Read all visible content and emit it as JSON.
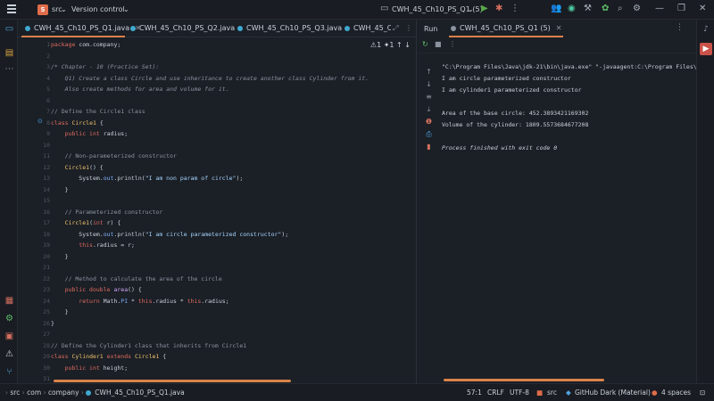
{
  "titlebar": {
    "project_badge": "S",
    "project_name": "src",
    "vcs_label": "Version control",
    "run_config": "CWH_45_Ch10_PS_Q1 (5)",
    "icons": [
      "menu-icon",
      "run-config-icon",
      "run-icon",
      "debug-icon",
      "more-icon",
      "collab-icon",
      "copilot-icon",
      "build-icon",
      "ai-icon",
      "search-icon",
      "settings-icon",
      "minimize-icon",
      "restore-icon",
      "close-icon"
    ]
  },
  "editor_tabs": [
    {
      "label": "CWH_45_Ch10_PS_Q1.java",
      "active": true
    },
    {
      "label": "CWH_45_Ch10_PS_Q2.java",
      "active": false
    },
    {
      "label": "CWH_45_Ch10_PS_Q3.java",
      "active": false
    },
    {
      "label": "CWH_45_C",
      "active": false
    }
  ],
  "editor": {
    "inspections": "⚠1 ✦1",
    "lines": [
      {
        "n": "1",
        "html": "<span class=\"kw\">package</span> com.company;"
      },
      {
        "n": "2",
        "html": ""
      },
      {
        "n": "3",
        "html": "<span class=\"cm\">/* Chapter - 10 (Practice Set):</span>"
      },
      {
        "n": "4",
        "html": "<span class=\"cm\">    Q1) Create a class Circle and use inheritance to create another class Cylinder from it.</span>"
      },
      {
        "n": "5",
        "html": "<span class=\"cm\">    Also create methods for area and volume for it.</span>"
      },
      {
        "n": "6",
        "html": ""
      },
      {
        "n": "7",
        "html": "<span class=\"cmn\">// Define the Circle1 class</span>"
      },
      {
        "n": "8",
        "html": "<span class=\"kw\">class</span> <span class=\"cls\">Circle1</span> {"
      },
      {
        "n": "9",
        "html": "    <span class=\"kw\">public int</span> radius;"
      },
      {
        "n": "10",
        "html": ""
      },
      {
        "n": "11",
        "html": "    <span class=\"cmn\">// Non-parameterized constructor</span>"
      },
      {
        "n": "12",
        "html": "    <span class=\"cls\">Circle1</span>() {"
      },
      {
        "n": "13",
        "html": "        System.<span class=\"fld\">out</span>.println(<span class=\"str\">\"I am non param of circle\"</span>);"
      },
      {
        "n": "14",
        "html": "    }"
      },
      {
        "n": "15",
        "html": ""
      },
      {
        "n": "16",
        "html": "    <span class=\"cmn\">// Parameterized constructor</span>"
      },
      {
        "n": "17",
        "html": "    <span class=\"cls\">Circle1</span>(<span class=\"kw\">int</span> r) {"
      },
      {
        "n": "18",
        "html": "        System.<span class=\"fld\">out</span>.println(<span class=\"str\">\"I am circle parameterized constructor\"</span>);"
      },
      {
        "n": "19",
        "html": "        <span class=\"kw\">this</span>.radius = r;"
      },
      {
        "n": "20",
        "html": "    }"
      },
      {
        "n": "21",
        "html": ""
      },
      {
        "n": "22",
        "html": "    <span class=\"cmn\">// Method to calculate the area of the circle</span>"
      },
      {
        "n": "23",
        "html": "    <span class=\"kw\">public double</span> <span class=\"fn\">area</span>() {"
      },
      {
        "n": "24",
        "html": "        <span class=\"kw\">return</span> Math.<span class=\"fld\">PI</span> * <span class=\"kw\">this</span>.radius * <span class=\"kw\">this</span>.radius;"
      },
      {
        "n": "25",
        "html": "    }"
      },
      {
        "n": "26",
        "html": "}"
      },
      {
        "n": "27",
        "html": ""
      },
      {
        "n": "28",
        "html": "<span class=\"cmn\">// Define the Cylinder1 class that inherits from Circle1</span>"
      },
      {
        "n": "29",
        "html": "<span class=\"kw\">class</span> <span class=\"cls\">Cylinder1</span> <span class=\"kw\">extends</span> <span class=\"cls\">Circle1</span> {"
      },
      {
        "n": "30",
        "html": "    <span class=\"kw\">public int</span> height;"
      },
      {
        "n": "31",
        "html": ""
      }
    ]
  },
  "run_panel": {
    "title": "Run",
    "tab_label": "CWH_45_Ch10_PS_Q1 (5)",
    "output": [
      {
        "text": "\"C:\\Program Files\\Java\\jdk-21\\bin\\java.exe\" \"-javaagent:C:\\Program Files\\J",
        "italic": false
      },
      {
        "text": "I am circle parameterized constructor",
        "italic": false
      },
      {
        "text": "I am cylinder1 parameterized constructor",
        "italic": false
      },
      {
        "text": "",
        "italic": false
      },
      {
        "text": "Area of the base circle: 452.3893421169302",
        "italic": false
      },
      {
        "text": "Volume of the cylinder: 1809.5573684677208",
        "italic": false
      },
      {
        "text": "",
        "italic": false
      },
      {
        "text": "Process finished with exit code 0",
        "italic": true
      }
    ]
  },
  "statusbar": {
    "breadcrumbs": [
      "src",
      "com",
      "company",
      "CWH_45_Ch10_PS_Q1.java"
    ],
    "position": "57:1",
    "line_ending": "CRLF",
    "encoding": "UTF-8",
    "module": "src",
    "theme": "GitHub Dark (Material)",
    "indent": "4 spaces"
  },
  "colors": {
    "accent": "#d9824a",
    "background": "#1b1f26",
    "keyword": "#e06c5f",
    "class": "#f0c36d",
    "string": "#a5d6ff"
  }
}
